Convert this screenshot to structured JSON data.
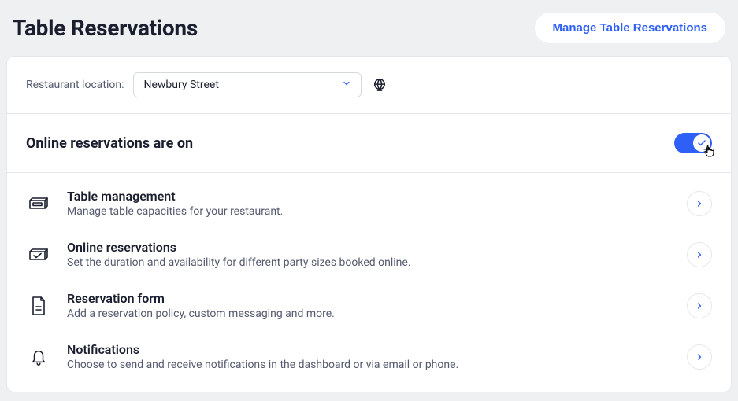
{
  "header": {
    "title": "Table Reservations",
    "manage_button": "Manage Table Reservations"
  },
  "location": {
    "label": "Restaurant location:",
    "selected": "Newbury Street"
  },
  "toggle": {
    "title": "Online reservations are on",
    "on": true
  },
  "items": [
    {
      "icon": "table-icon",
      "title": "Table management",
      "desc": "Manage table capacities for your restaurant."
    },
    {
      "icon": "calendar-check-icon",
      "title": "Online reservations",
      "desc": "Set the duration and availability for different party sizes booked online."
    },
    {
      "icon": "form-icon",
      "title": "Reservation form",
      "desc": "Add a reservation policy, custom messaging and more."
    },
    {
      "icon": "bell-icon",
      "title": "Notifications",
      "desc": "Choose to send and receive notifications in the dashboard or via email or phone."
    }
  ]
}
